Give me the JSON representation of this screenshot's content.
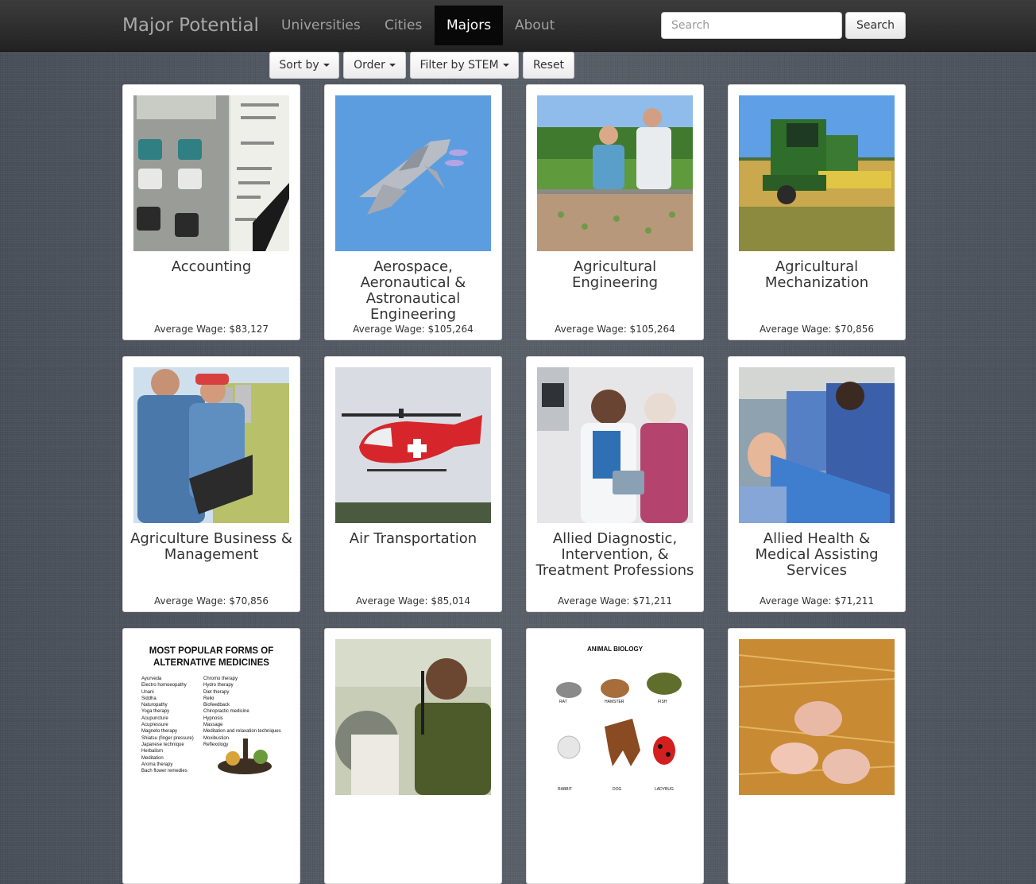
{
  "navbar": {
    "brand": "Major Potential",
    "items": [
      {
        "label": "Universities",
        "active": false
      },
      {
        "label": "Cities",
        "active": false
      },
      {
        "label": "Majors",
        "active": true
      },
      {
        "label": "About",
        "active": false
      }
    ],
    "search": {
      "placeholder": "Search",
      "value": "",
      "button_label": "Search"
    }
  },
  "filters": {
    "sort_by_label": "Sort by",
    "order_label": "Order",
    "filter_stem_label": "Filter by STEM",
    "reset_label": "Reset"
  },
  "wage_prefix": "Average Wage: ",
  "majors": [
    {
      "name": "Accounting",
      "wage": "Average Wage: $83,127",
      "image_icon": "calculator-icon"
    },
    {
      "name": "Aerospace, Aeronautical & Astronautical Engineering",
      "wage": "Average Wage: $105,264",
      "image_icon": "jet-icon"
    },
    {
      "name": "Agricultural Engineering",
      "wage": "Average Wage: $105,264",
      "image_icon": "field-workers-icon"
    },
    {
      "name": "Agricultural Mechanization",
      "wage": "Average Wage: $70,856",
      "image_icon": "combine-harvester-icon"
    },
    {
      "name": "Agriculture Business & Management",
      "wage": "Average Wage: $70,856",
      "image_icon": "farmers-laptop-icon"
    },
    {
      "name": "Air Transportation",
      "wage": "Average Wage: $85,014",
      "image_icon": "helicopter-icon"
    },
    {
      "name": "Allied Diagnostic, Intervention, & Treatment Professions",
      "wage": "Average Wage: $71,211",
      "image_icon": "doctor-patient-icon"
    },
    {
      "name": "Allied Health & Medical Assisting Services",
      "wage": "Average Wage: $71,211",
      "image_icon": "medical-training-icon"
    },
    {
      "name": "",
      "wage": "",
      "image_icon": "alternative-medicine-poster-icon",
      "poster": {
        "heading_1": "MOST POPULAR FORMS OF",
        "heading_2": "ALTERNATIVE MEDICINES",
        "col1": [
          "Ayurveda",
          "Electro homoeopathy",
          "Unani",
          "Siddha",
          "Naturopathy",
          "Yoga therapy",
          "Acupuncture",
          "Acupressure",
          "Magneto therapy",
          "Shiatsu (finger pressure)",
          "Japanese technique",
          "Herbalism",
          "Meditation",
          "Aroma therapy",
          "Bach flower remedies"
        ],
        "col2": [
          "Chromo therapy",
          "Hydro therapy",
          "Diet therapy",
          "Reiki",
          "Biofeedback",
          "Chiropractic medicine",
          "Hypnosis",
          "Massage",
          "Meditation and relaxation techniques",
          "Moxibustion",
          "Reflexology"
        ]
      }
    },
    {
      "name": "",
      "wage": "",
      "image_icon": "interview-microphone-icon"
    },
    {
      "name": "",
      "wage": "",
      "image_icon": "animal-biology-icon",
      "poster": {
        "heading": "ANIMAL BIOLOGY",
        "labels": [
          "RAT",
          "HAMSTER",
          "FISH",
          "RABBIT",
          "DOG",
          "LADYBUG"
        ]
      }
    },
    {
      "name": "",
      "wage": "",
      "image_icon": "piglets-icon"
    }
  ],
  "colors": {
    "navbar": "#222222",
    "active_nav": "#080808",
    "card": "#ffffff",
    "background": "#545a64"
  }
}
